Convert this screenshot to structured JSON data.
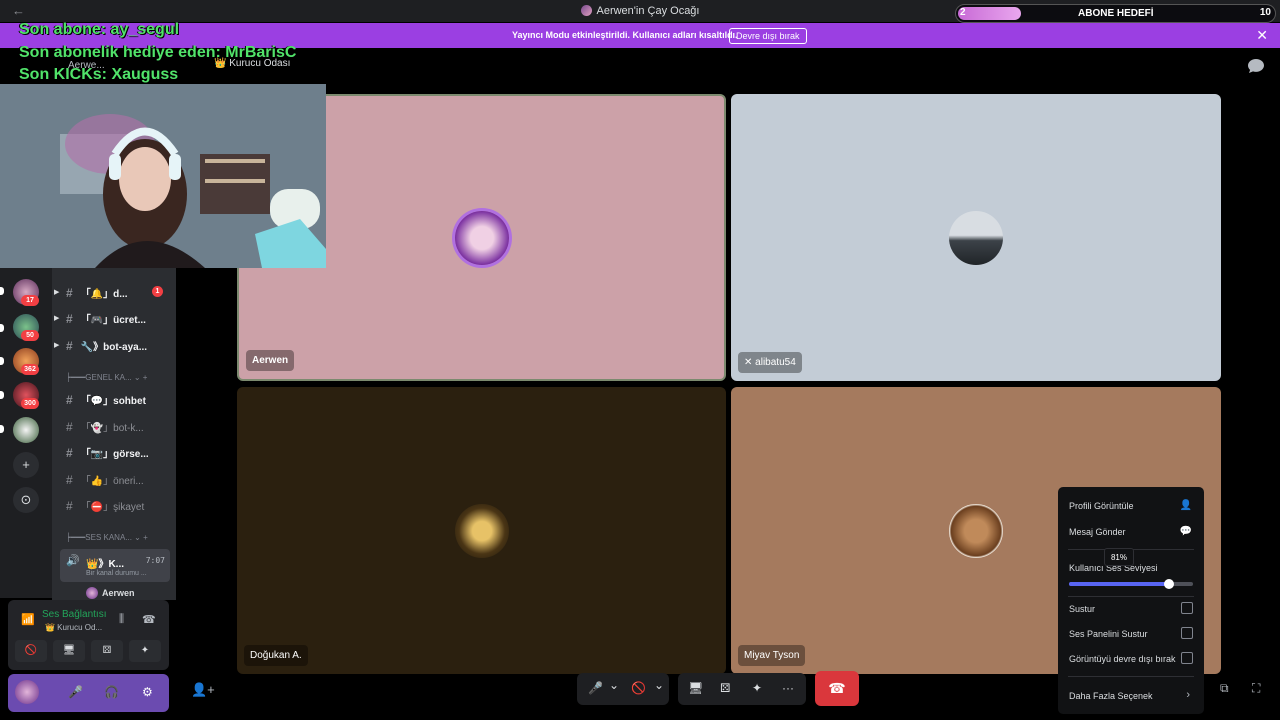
{
  "window": {
    "title": "Aerwen'in Çay Ocağı",
    "back_icon": "←",
    "minimize": "—",
    "maximize": "☐",
    "close": "✕"
  },
  "sub_goal": {
    "current": "2",
    "label": "ABONE HEDEFİ",
    "target": "10",
    "progress": 0.2
  },
  "banner": {
    "message": "Yayıncı Modu etkinleştirildi. Kullanıcı adları kısaltıldı.",
    "button": "Devre dışı bırak",
    "close": "✕",
    "color": "#9b3fe2"
  },
  "alerts": {
    "sub": "Son abone: ay_segul",
    "gift": "Son abonelik hediye eden: MrBarisC",
    "kicks": "Son KICKs: Xauguss"
  },
  "header": {
    "server_short": "Aerwe...",
    "channel": "👑 Kurucu Odası"
  },
  "servers": [
    {
      "badge": "17"
    },
    {
      "badge": "50"
    },
    {
      "badge": "362"
    },
    {
      "badge": "300"
    },
    {
      "badge": ""
    }
  ],
  "channels": {
    "text": [
      {
        "label": "「🔔」d...",
        "unread": "1"
      },
      {
        "label": "「🎮」ücret..."
      },
      {
        "label": "🔧》bot-aya..."
      }
    ],
    "cat_general": "GENEL KA...",
    "general": [
      {
        "label": "「💬」sohbet"
      },
      {
        "label": "「👻」bot-k..."
      },
      {
        "label": "「📷」görse..."
      },
      {
        "label": "「👍」öneri..."
      },
      {
        "label": "「⛔」şikayet"
      }
    ],
    "cat_voice": "SES KANA...",
    "voice": {
      "label": "👑》K...",
      "time": "7:07",
      "status": "Bir kanal durumu ..."
    },
    "voice_user": "Aerwen"
  },
  "voice_panel": {
    "connection": "Ses Bağlantısı",
    "channel": "👑 Kurucu Od..."
  },
  "tiles": [
    {
      "name": "Aerwen",
      "bg": "#cca1a8"
    },
    {
      "name": "alibatu54",
      "bg": "#c3ccd6"
    },
    {
      "name": "Doğukan A.",
      "bg": "#2b200f"
    },
    {
      "name": "Miyav Tyson",
      "bg": "#a57a5e"
    }
  ],
  "context_menu": {
    "view_profile": "Profili Görüntüle",
    "send_message": "Mesaj Gönder",
    "user_volume": "Kullanıcı Ses Seviyesi",
    "volume": 0.81,
    "volume_label": "81%",
    "mute": "Sustur",
    "mute_soundboard": "Ses Panelini Sustur",
    "disable_video": "Görüntüyü devre dışı bırak",
    "more_options": "Daha Fazla Seçenek"
  },
  "icons": {
    "mic": "🎤",
    "camera_off": "🚫",
    "screen_share": "🖥",
    "activities": "⚄",
    "effects": "✦",
    "more": "···",
    "end_call": "☎",
    "popout": "⧉",
    "fullscreen": "⛶",
    "settings": "⚙",
    "headphones": "🎧",
    "add": "+",
    "discover": "⊙",
    "chevron": "⌄"
  }
}
